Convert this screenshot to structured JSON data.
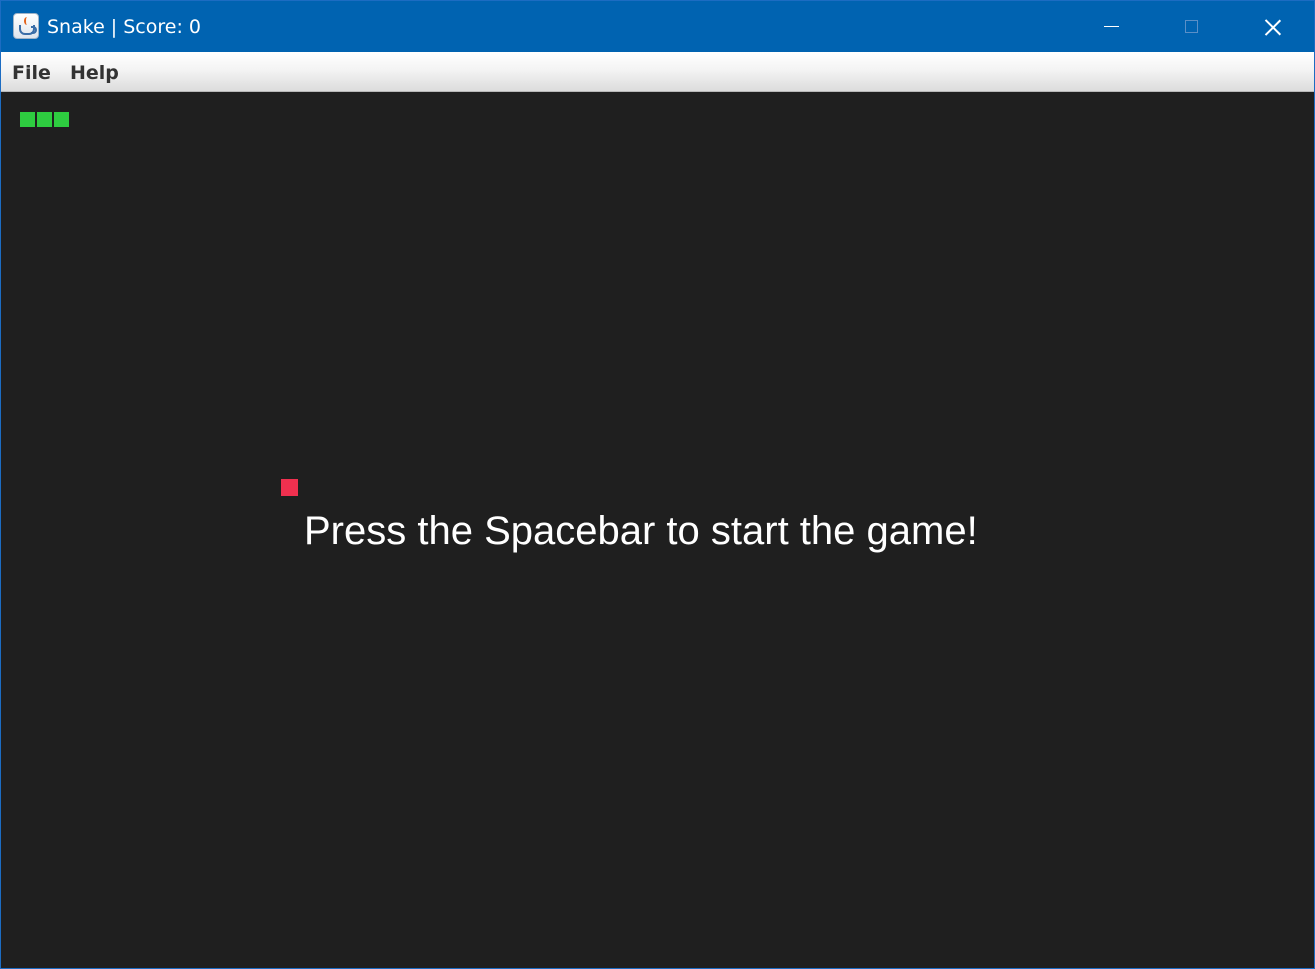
{
  "window": {
    "title": "Snake | Score: 0",
    "icon": "java-cup-icon",
    "controls": [
      "minimize-icon",
      "maximize-icon",
      "close-icon"
    ]
  },
  "menu": {
    "items": [
      {
        "label": "File"
      },
      {
        "label": "Help"
      }
    ]
  },
  "game": {
    "message": "Press the Spacebar to start the game!",
    "colors": {
      "background": "#1f1f1f",
      "snake": "#2ecc40",
      "food": "#f0304f",
      "text": "#ffffff"
    },
    "snake_length": 3
  }
}
